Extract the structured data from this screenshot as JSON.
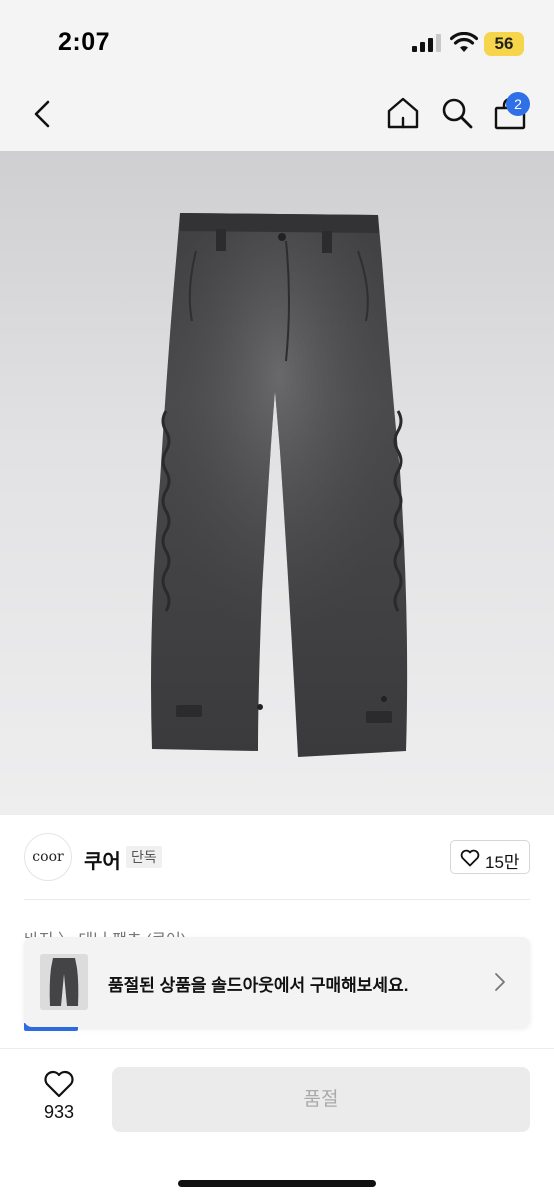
{
  "status_bar": {
    "time": "2:07",
    "battery": "56"
  },
  "nav": {
    "cart_count": "2",
    "icons": [
      "chevron-left-icon",
      "home-icon",
      "search-icon",
      "shopping-bag-icon"
    ]
  },
  "product": {
    "image_subject": "gray washed denim pants",
    "brand_logo_text": "coor",
    "brand_name": "쿠어",
    "brand_tag": "단독",
    "like_count": "15만",
    "breadcrumb": "바지 〉 데님 팬츠 (쿠어)"
  },
  "soldout_banner": {
    "text": "품절된 상품을 솔드아웃에서 구매해보세요."
  },
  "bottom_bar": {
    "wish_count": "933",
    "buy_label": "품절"
  },
  "colors": {
    "accent": "#2f6fe8",
    "battery": "#f7d54a",
    "disabled_button": "#ebebeb"
  }
}
